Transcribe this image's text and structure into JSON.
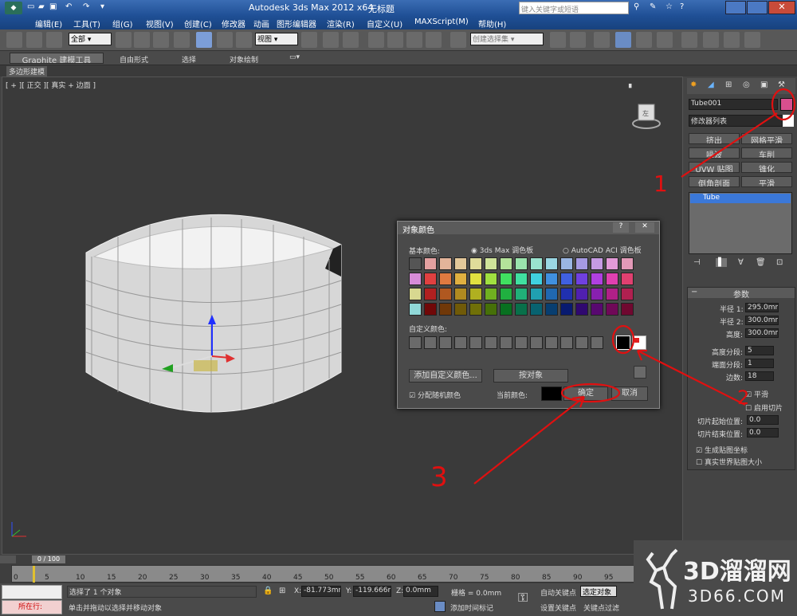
{
  "app": {
    "title": "Autodesk 3ds Max  2012  x64",
    "document": "无标题",
    "search_placeholder": "键入关键字或短语"
  },
  "menu": [
    "编辑(E)",
    "工具(T)",
    "组(G)",
    "视图(V)",
    "创建(C)",
    "修改器",
    "动画",
    "图形编辑器",
    "渲染(R)",
    "自定义(U)",
    "MAXScript(M)",
    "帮助(H)"
  ],
  "toolbar": {
    "filter": "全部",
    "view_ref": "视图",
    "selection_set": "创建选择集"
  },
  "ribbon": {
    "tabs": [
      "Graphite 建模工具",
      "自由形式",
      "选择",
      "对象绘制"
    ],
    "subtab": "多边形建模"
  },
  "viewport": {
    "label": "[ + ][ 正交 ][ 真实 + 边面 ]",
    "cube_label": "左"
  },
  "panel": {
    "object_name": "Tube001",
    "object_color": "#d94f8e",
    "modifier_list": "修改器列表",
    "modifier_buttons": [
      "挤出",
      "网格平滑",
      "噪波",
      "车削",
      "UVW 贴图",
      "锥化",
      "倒角剖面",
      "平滑"
    ],
    "stack_item": "Tube",
    "params_title": "参数",
    "params": [
      {
        "label": "半径 1:",
        "value": "295.0mm"
      },
      {
        "label": "半径 2:",
        "value": "300.0mm"
      },
      {
        "label": "高度:",
        "value": "300.0mm"
      },
      {
        "label": "高度分段:",
        "value": "5"
      },
      {
        "label": "端面分段:",
        "value": "1"
      },
      {
        "label": "边数:",
        "value": "18"
      }
    ],
    "smooth": "平滑",
    "slice_on": "启用切片",
    "slice_from": {
      "label": "切片起始位置:",
      "value": "0.0"
    },
    "slice_to": {
      "label": "切片结束位置:",
      "value": "0.0"
    },
    "gen_mapping": "生成贴图坐标",
    "real_world": "真实世界贴图大小"
  },
  "dialog": {
    "title": "对象颜色",
    "basic_label": "基本颜色:",
    "palette1": "3ds Max 调色板",
    "palette2": "AutoCAD ACI 调色板",
    "custom_label": "自定义颜色:",
    "add_custom": "添加自定义颜色...",
    "by_object": "按对象",
    "random": "分配随机颜色",
    "current": "当前颜色:",
    "ok": "确定",
    "cancel": "取消"
  },
  "timeline": {
    "range": "0 / 100",
    "ticks": [
      "0",
      "5",
      "10",
      "15",
      "20",
      "25",
      "30",
      "35",
      "40",
      "45",
      "50",
      "55",
      "60",
      "65",
      "70",
      "75",
      "80",
      "85",
      "90",
      "95"
    ]
  },
  "status": {
    "mode_label": "所在行:",
    "selected": "选择了 1 个对象",
    "hint": "单击并拖动以选择并移动对象",
    "x_label": "X:",
    "x": "-81.773mm",
    "y_label": "Y:",
    "y": "-119.666m",
    "z_label": "Z:",
    "z": "0.0mm",
    "grid": "栅格 = 0.0mm",
    "add_time_tag": "添加时间标记",
    "auto_key": "自动关键点",
    "set_key": "设置关键点",
    "selected_obj": "选定对象",
    "key_filters": "关键点过滤"
  },
  "watermark": {
    "brand": "3D溜溜网",
    "url": "3D66.COM"
  },
  "annotations": [
    "1",
    "2",
    "3"
  ],
  "colors": {
    "accent": "#ff2020",
    "selected_stack": "#3b78d8"
  }
}
